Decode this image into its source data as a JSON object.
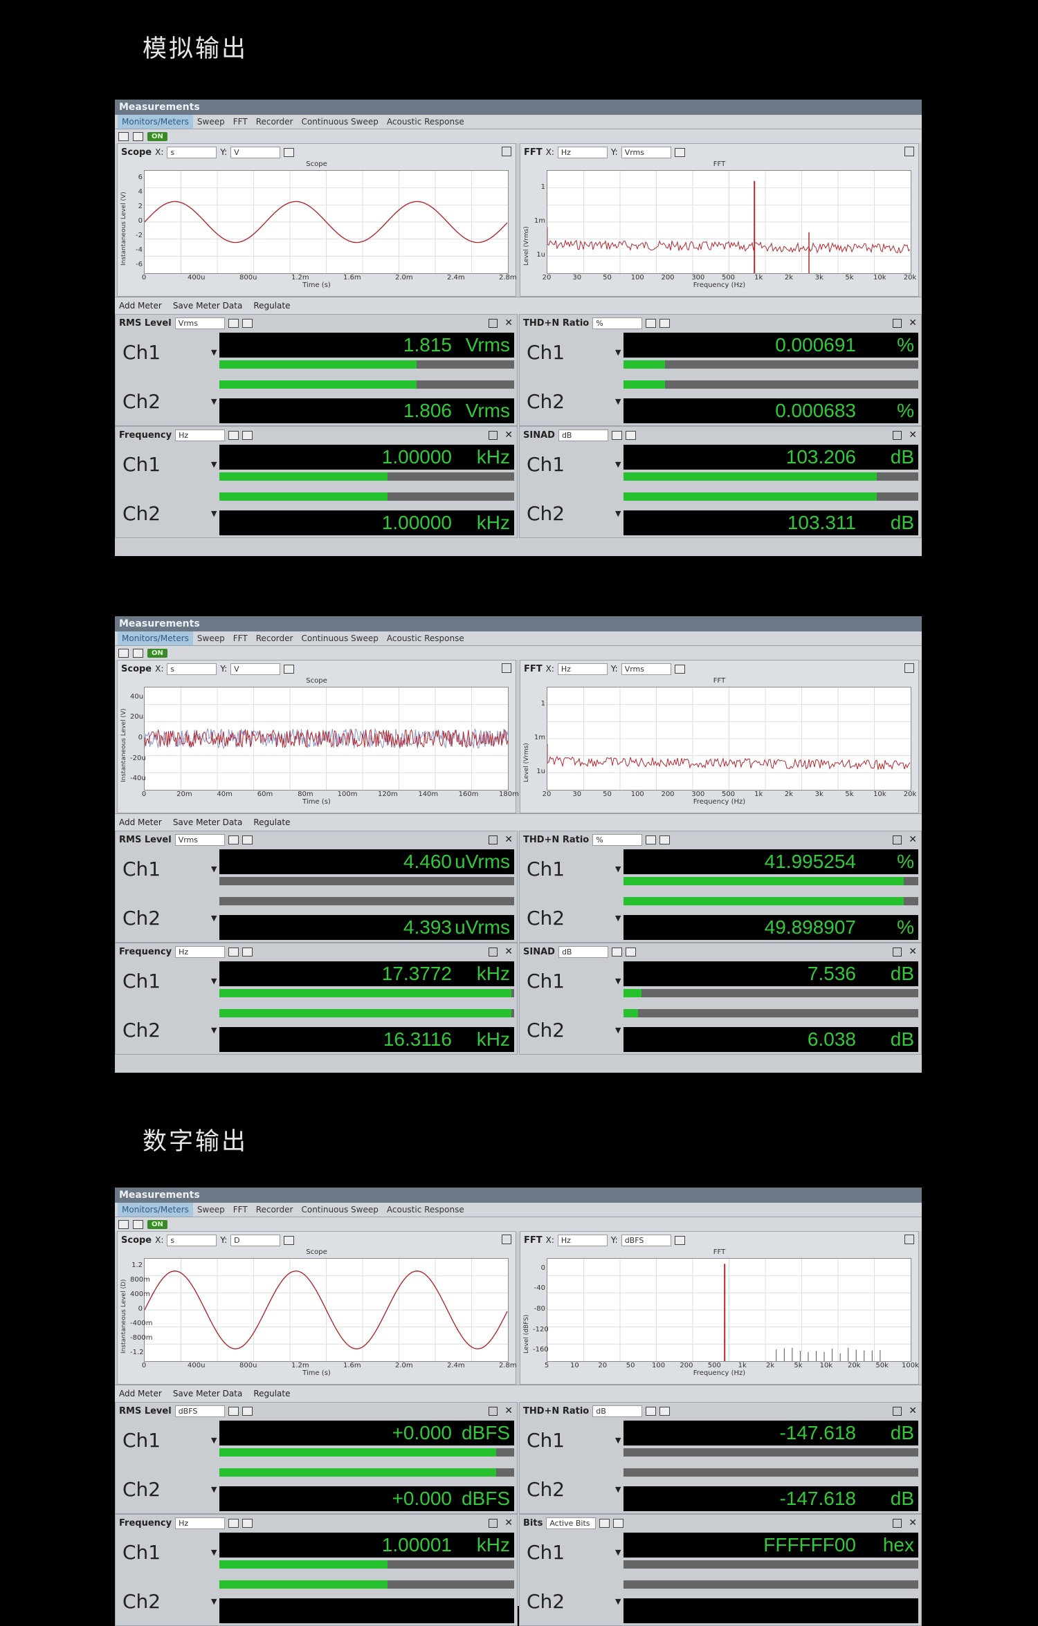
{
  "headings": {
    "analog": "模拟输出",
    "digital": "数字输出"
  },
  "colors": {
    "green": "#31c93a",
    "trace": "#b3282f",
    "window_title": "#6c7886"
  },
  "windows": [
    {
      "title": "Measurements",
      "tabs": [
        "Monitors/Meters",
        "Sweep",
        "FFT",
        "Recorder",
        "Continuous Sweep",
        "Acoustic Response"
      ],
      "on_label": "ON",
      "scope": {
        "label": "Scope",
        "x_label": "X:",
        "x_unit": "s",
        "y_label": "Y:",
        "y_unit": "V",
        "title": "Scope",
        "ylabel": "Instantaneous Level (V)",
        "xlabel": "Time (s)",
        "yticks": [
          "6",
          "4",
          "2",
          "0",
          "-2",
          "-4",
          "-6"
        ],
        "xticks": [
          "0",
          "400u",
          "800u",
          "1.2m",
          "1.6m",
          "2.0m",
          "2.4m",
          "2.8m"
        ]
      },
      "fft": {
        "label": "FFT",
        "x_label": "X:",
        "x_unit": "Hz",
        "y_label": "Y:",
        "y_unit": "Vrms",
        "title": "FFT",
        "ylabel": "Level (Vrms)",
        "xlabel": "Frequency (Hz)",
        "yticks": [
          "1",
          "1m",
          "1u"
        ],
        "xticks": [
          "20",
          "30",
          "50",
          "100",
          "200",
          "300",
          "500",
          "1k",
          "2k",
          "3k",
          "5k",
          "10k",
          "20k"
        ]
      },
      "toolbar": {
        "add": "Add Meter",
        "save": "Save Meter Data",
        "regulate": "Regulate"
      },
      "meters": [
        {
          "name": "RMS Level",
          "unit_sel": "Vrms",
          "ch": [
            {
              "label": "Ch1",
              "value": "1.815",
              "unit": "Vrms",
              "fill": 0.67
            },
            {
              "label": "Ch2",
              "value": "1.806",
              "unit": "Vrms",
              "fill": 0.67
            }
          ]
        },
        {
          "name": "THD+N Ratio",
          "unit_sel": "%",
          "ch": [
            {
              "label": "Ch1",
              "value": "0.000691",
              "unit": "%",
              "fill": 0.14
            },
            {
              "label": "Ch2",
              "value": "0.000683",
              "unit": "%",
              "fill": 0.14
            }
          ]
        },
        {
          "name": "Frequency",
          "unit_sel": "Hz",
          "ch": [
            {
              "label": "Ch1",
              "value": "1.00000",
              "unit": "kHz",
              "fill": 0.57
            },
            {
              "label": "Ch2",
              "value": "1.00000",
              "unit": "kHz",
              "fill": 0.57
            }
          ]
        },
        {
          "name": "SINAD",
          "unit_sel": "dB",
          "ch": [
            {
              "label": "Ch1",
              "value": "103.206",
              "unit": "dB",
              "fill": 0.86
            },
            {
              "label": "Ch2",
              "value": "103.311",
              "unit": "dB",
              "fill": 0.86
            }
          ]
        }
      ]
    },
    {
      "title": "Measurements",
      "tabs": [
        "Monitors/Meters",
        "Sweep",
        "FFT",
        "Recorder",
        "Continuous Sweep",
        "Acoustic Response"
      ],
      "on_label": "ON",
      "scope": {
        "label": "Scope",
        "x_label": "X:",
        "x_unit": "s",
        "y_label": "Y:",
        "y_unit": "V",
        "title": "Scope",
        "ylabel": "Instantaneous Level (V)",
        "xlabel": "Time (s)",
        "yticks": [
          "40u",
          "20u",
          "0",
          "-20u",
          "-40u"
        ],
        "xticks": [
          "0",
          "20m",
          "40m",
          "60m",
          "80m",
          "100m",
          "120m",
          "140m",
          "160m",
          "180m"
        ]
      },
      "fft": {
        "label": "FFT",
        "x_label": "X:",
        "x_unit": "Hz",
        "y_label": "Y:",
        "y_unit": "Vrms",
        "title": "FFT",
        "ylabel": "Level (Vrms)",
        "xlabel": "Frequency (Hz)",
        "yticks": [
          "1",
          "1m",
          "1u"
        ],
        "xticks": [
          "20",
          "30",
          "50",
          "100",
          "200",
          "300",
          "500",
          "1k",
          "2k",
          "3k",
          "5k",
          "10k",
          "20k"
        ]
      },
      "toolbar": {
        "add": "Add Meter",
        "save": "Save Meter Data",
        "regulate": "Regulate"
      },
      "meters": [
        {
          "name": "RMS Level",
          "unit_sel": "Vrms",
          "ch": [
            {
              "label": "Ch1",
              "value": "4.460",
              "unit": "uVrms",
              "fill": 0.0
            },
            {
              "label": "Ch2",
              "value": "4.393",
              "unit": "uVrms",
              "fill": 0.0
            }
          ]
        },
        {
          "name": "THD+N Ratio",
          "unit_sel": "%",
          "ch": [
            {
              "label": "Ch1",
              "value": "41.995254",
              "unit": "%",
              "fill": 0.95
            },
            {
              "label": "Ch2",
              "value": "49.898907",
              "unit": "%",
              "fill": 0.95
            }
          ]
        },
        {
          "name": "Frequency",
          "unit_sel": "Hz",
          "ch": [
            {
              "label": "Ch1",
              "value": "17.3772",
              "unit": "kHz",
              "fill": 0.99
            },
            {
              "label": "Ch2",
              "value": "16.3116",
              "unit": "kHz",
              "fill": 0.99
            }
          ]
        },
        {
          "name": "SINAD",
          "unit_sel": "dB",
          "ch": [
            {
              "label": "Ch1",
              "value": "7.536",
              "unit": "dB",
              "fill": 0.06
            },
            {
              "label": "Ch2",
              "value": "6.038",
              "unit": "dB",
              "fill": 0.05
            }
          ]
        }
      ]
    },
    {
      "title": "Measurements",
      "tabs": [
        "Monitors/Meters",
        "Sweep",
        "FFT",
        "Recorder",
        "Continuous Sweep",
        "Acoustic Response"
      ],
      "on_label": "ON",
      "scope": {
        "label": "Scope",
        "x_label": "X:",
        "x_unit": "s",
        "y_label": "Y:",
        "y_unit": "D",
        "title": "Scope",
        "ylabel": "Instantaneous Level (D)",
        "xlabel": "Time (s)",
        "yticks": [
          "1.2",
          "800m",
          "400m",
          "0",
          "-400m",
          "-800m",
          "-1.2"
        ],
        "xticks": [
          "0",
          "400u",
          "800u",
          "1.2m",
          "1.6m",
          "2.0m",
          "2.4m",
          "2.8m"
        ]
      },
      "fft": {
        "label": "FFT",
        "x_label": "X:",
        "x_unit": "Hz",
        "y_label": "Y:",
        "y_unit": "dBFS",
        "title": "FFT",
        "ylabel": "Level (dBFS)",
        "xlabel": "Frequency (Hz)",
        "yticks": [
          "0",
          "-40",
          "-80",
          "-120",
          "-160"
        ],
        "xticks": [
          "5",
          "10",
          "20",
          "50",
          "100",
          "200",
          "500",
          "1k",
          "2k",
          "5k",
          "10k",
          "20k",
          "50k",
          "100k"
        ]
      },
      "toolbar": {
        "add": "Add Meter",
        "save": "Save Meter Data",
        "regulate": "Regulate"
      },
      "meters": [
        {
          "name": "RMS Level",
          "unit_sel": "dBFS",
          "ch": [
            {
              "label": "Ch1",
              "value": "+0.000",
              "unit": "dBFS",
              "fill": 0.94
            },
            {
              "label": "Ch2",
              "value": "+0.000",
              "unit": "dBFS",
              "fill": 0.94
            }
          ]
        },
        {
          "name": "THD+N Ratio",
          "unit_sel": "dB",
          "ch": [
            {
              "label": "Ch1",
              "value": "-147.618",
              "unit": "dB",
              "fill": 0.0
            },
            {
              "label": "Ch2",
              "value": "-147.618",
              "unit": "dB",
              "fill": 0.0
            }
          ]
        },
        {
          "name": "Frequency",
          "unit_sel": "Hz",
          "ch": [
            {
              "label": "Ch1",
              "value": "1.00001",
              "unit": "kHz",
              "fill": 0.57
            },
            {
              "label": "Ch2",
              "value": "",
              "unit": "",
              "fill": 0.57
            }
          ]
        },
        {
          "name": "Bits",
          "unit_sel": "Active Bits",
          "ch": [
            {
              "label": "Ch1",
              "value": "FFFFFF00",
              "unit": "hex",
              "fill": 0.0
            },
            {
              "label": "Ch2",
              "value": "",
              "unit": "",
              "fill": 0.0
            }
          ]
        }
      ]
    }
  ]
}
